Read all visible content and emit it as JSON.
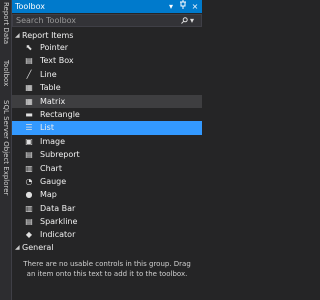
{
  "side_tabs": [
    "Report Data",
    "Toolbox",
    "SQL Server Object Explorer"
  ],
  "window": {
    "title": "Toolbox"
  },
  "search": {
    "placeholder": "Search Toolbox",
    "icon": "search-icon"
  },
  "groups": [
    {
      "label": "Report Items",
      "expanded": true,
      "items": [
        {
          "label": "Pointer",
          "icon": "pointer-icon",
          "state": ""
        },
        {
          "label": "Text Box",
          "icon": "textbox-icon",
          "state": ""
        },
        {
          "label": "Line",
          "icon": "line-icon",
          "state": ""
        },
        {
          "label": "Table",
          "icon": "table-icon",
          "state": ""
        },
        {
          "label": "Matrix",
          "icon": "matrix-icon",
          "state": "hover"
        },
        {
          "label": "Rectangle",
          "icon": "rectangle-icon",
          "state": ""
        },
        {
          "label": "List",
          "icon": "list-icon",
          "state": "selected"
        },
        {
          "label": "Image",
          "icon": "image-icon",
          "state": ""
        },
        {
          "label": "Subreport",
          "icon": "subreport-icon",
          "state": ""
        },
        {
          "label": "Chart",
          "icon": "chart-icon",
          "state": ""
        },
        {
          "label": "Gauge",
          "icon": "gauge-icon",
          "state": ""
        },
        {
          "label": "Map",
          "icon": "map-icon",
          "state": ""
        },
        {
          "label": "Data Bar",
          "icon": "databar-icon",
          "state": ""
        },
        {
          "label": "Sparkline",
          "icon": "sparkline-icon",
          "state": ""
        },
        {
          "label": "Indicator",
          "icon": "indicator-icon",
          "state": ""
        }
      ]
    },
    {
      "label": "General",
      "expanded": true,
      "empty_message": "There are no usable controls in this group. Drag an item onto this text to add it to the toolbox."
    }
  ],
  "colors": {
    "accent": "#007acc",
    "selected": "#3399ff",
    "background": "#252526"
  }
}
